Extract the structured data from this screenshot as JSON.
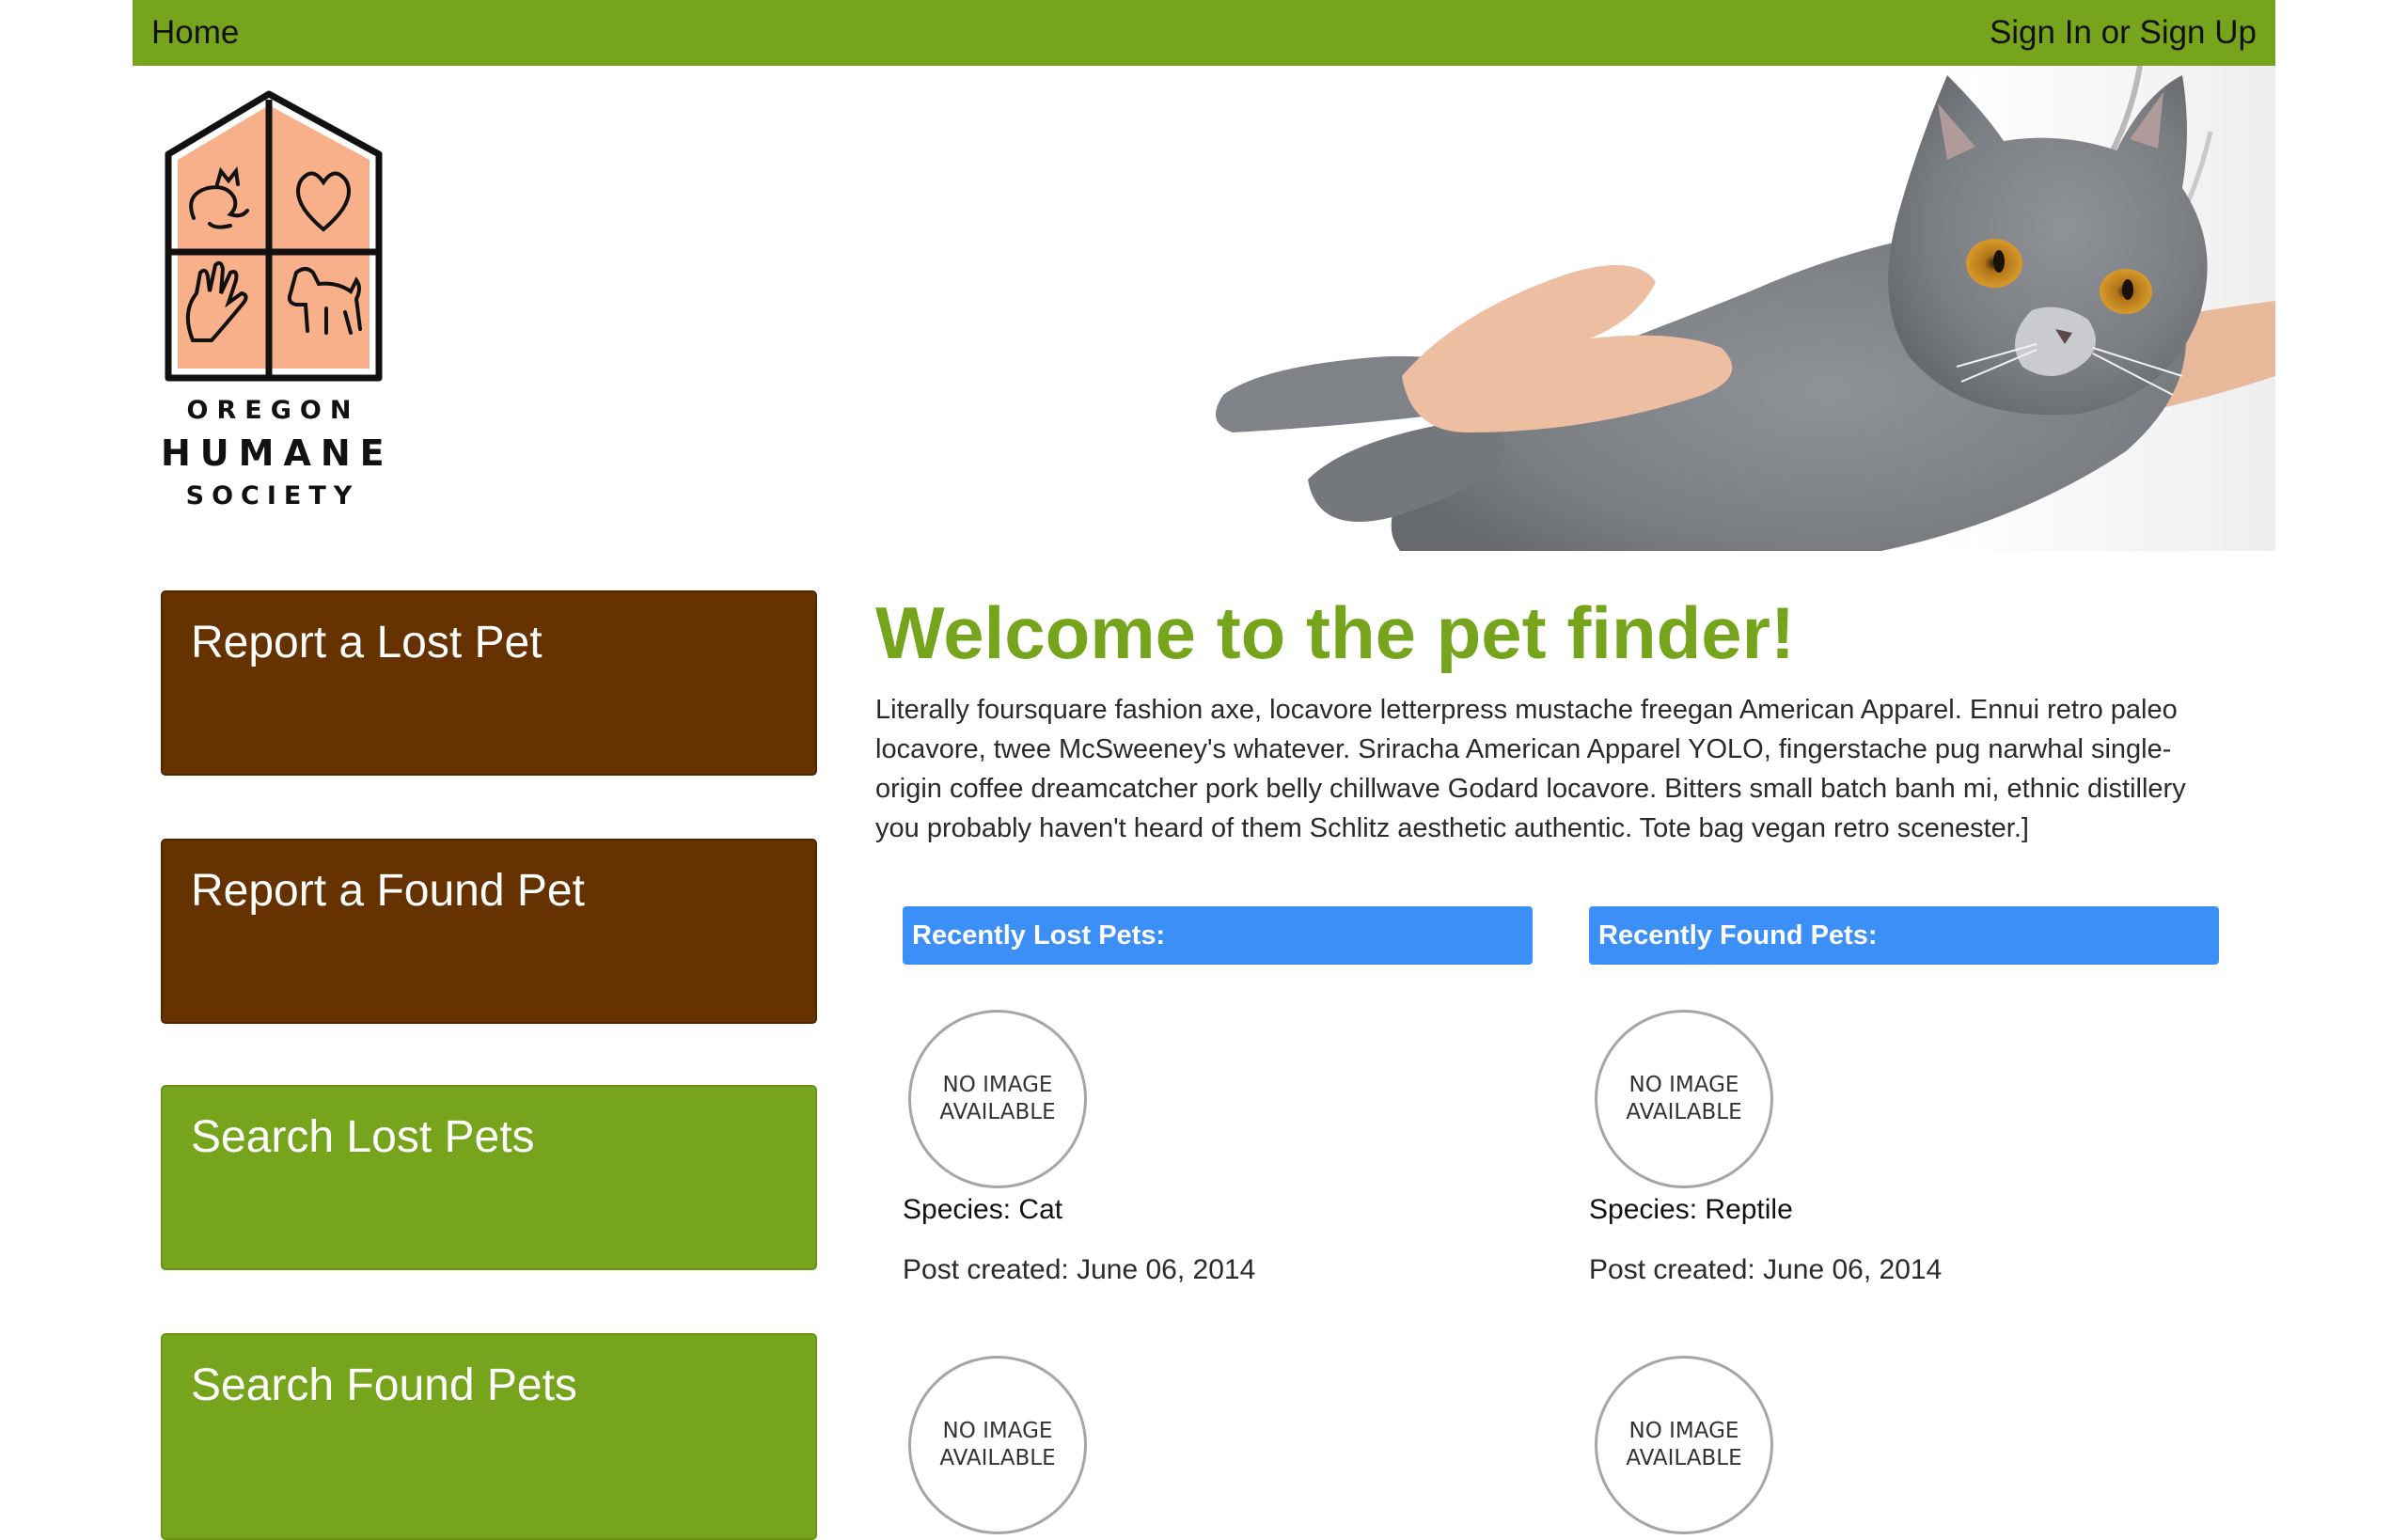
{
  "colors": {
    "brand_green": "#76a51d",
    "brand_brown": "#663300",
    "header_blue": "#3b8ff7",
    "logo_peach": "#f8b08a"
  },
  "navbar": {
    "home_label": "Home",
    "sign_label": "Sign In or Sign Up"
  },
  "logo": {
    "line1": "OREGON",
    "line2": "HUMANE",
    "line3": "SOCIETY",
    "icons": [
      "cat-icon",
      "heart-icon",
      "hand-icon",
      "dog-icon"
    ]
  },
  "hero": {
    "subject": "gray-cat-held-in-hands"
  },
  "sidebar": {
    "items": [
      {
        "label": "Report a Lost Pet"
      },
      {
        "label": "Report a Found Pet"
      },
      {
        "label": "Search Lost Pets"
      },
      {
        "label": "Search Found Pets"
      }
    ]
  },
  "main": {
    "title": "Welcome to the pet finder!",
    "intro": "Literally foursquare fashion axe, locavore letterpress mustache freegan American Apparel. Ennui retro paleo locavore, twee McSweeney's whatever. Sriracha American Apparel YOLO, fingerstache pug narwhal single-origin coffee dreamcatcher pork belly chillwave Godard locavore. Bitters small batch banh mi, ethnic distillery you probably haven't heard of them Schlitz aesthetic authentic. Tote bag vegan retro scenester.]",
    "lost": {
      "header": "Recently Lost Pets:",
      "pets": [
        {
          "image_line1": "NO IMAGE",
          "image_line2": "AVAILABLE",
          "species": "Species: Cat",
          "posted": "Post created: June 06, 2014"
        },
        {
          "image_line1": "NO IMAGE",
          "image_line2": "AVAILABLE"
        }
      ]
    },
    "found": {
      "header": "Recently Found Pets:",
      "pets": [
        {
          "image_line1": "NO IMAGE",
          "image_line2": "AVAILABLE",
          "species": "Species: Reptile",
          "posted": "Post created: June 06, 2014"
        },
        {
          "image_line1": "NO IMAGE",
          "image_line2": "AVAILABLE"
        }
      ]
    }
  }
}
